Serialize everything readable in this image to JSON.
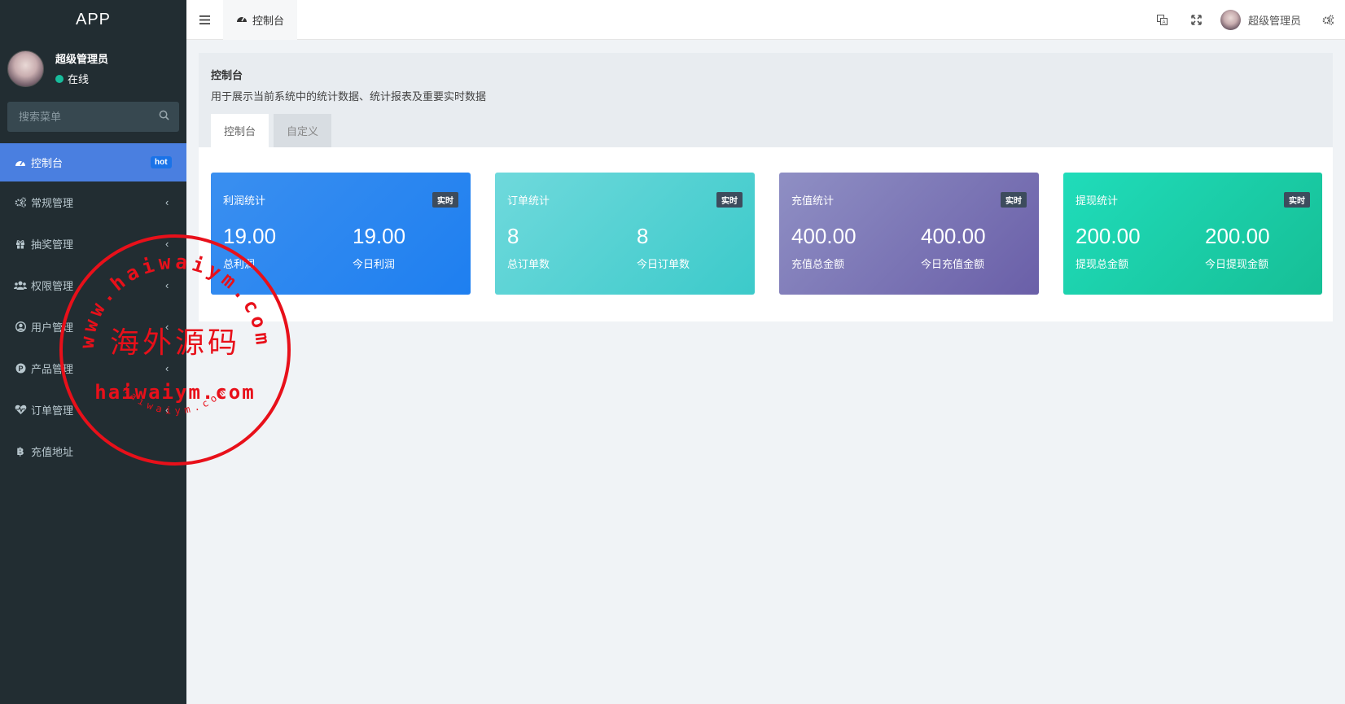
{
  "app": {
    "title": "APP"
  },
  "user": {
    "name": "超级管理员",
    "status": "在线"
  },
  "search": {
    "placeholder": "搜索菜单"
  },
  "menu": [
    {
      "label": "控制台",
      "icon": "dashboard-icon",
      "badge": "hot",
      "active": true
    },
    {
      "label": "常规管理",
      "icon": "cogs-icon"
    },
    {
      "label": "抽奖管理",
      "icon": "gift-icon"
    },
    {
      "label": "权限管理",
      "icon": "group-icon"
    },
    {
      "label": "用户管理",
      "icon": "user-circle-icon"
    },
    {
      "label": "产品管理",
      "icon": "product-p-icon"
    },
    {
      "label": "订单管理",
      "icon": "heartbeat-icon"
    },
    {
      "label": "充值地址",
      "icon": "bitcoin-icon"
    }
  ],
  "header": {
    "tab": "控制台",
    "user_name": "超级管理员"
  },
  "panel": {
    "title": "控制台",
    "subtitle": "用于展示当前系统中的统计数据、统计报表及重要实时数据",
    "tabs": [
      "控制台",
      "自定义"
    ]
  },
  "cards": [
    {
      "title": "利润统计",
      "badge": "实时",
      "v1": "19.00",
      "l1": "总利润",
      "v2": "19.00",
      "l2": "今日利润",
      "color": "#2b88f0"
    },
    {
      "title": "订单统计",
      "badge": "实时",
      "v1": "8",
      "l1": "总订单数",
      "v2": "8",
      "l2": "今日订单数",
      "color": "#52d1d3"
    },
    {
      "title": "充值统计",
      "badge": "实时",
      "v1": "400.00",
      "l1": "充值总金额",
      "v2": "400.00",
      "l2": "今日充值金额",
      "color": "#7a70b5"
    },
    {
      "title": "提现统计",
      "badge": "实时",
      "v1": "200.00",
      "l1": "提现总金额",
      "v2": "200.00",
      "l2": "今日提现金额",
      "color": "#19cda8"
    }
  ],
  "watermark": {
    "ring_text": "www.haiwaiym.com",
    "center_text": "海外源码",
    "domain": "haiwaiym.com",
    "small_text": "haiwaiym.com",
    "color": "#e8101a"
  }
}
